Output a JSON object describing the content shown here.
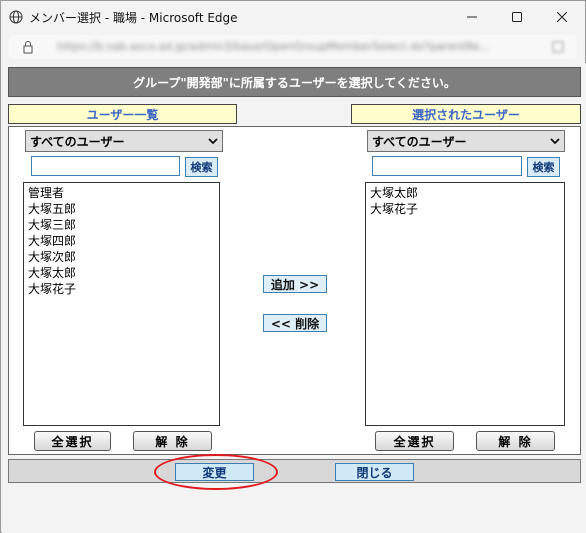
{
  "window": {
    "title": "メンバー選択 - 職場 - Microsoft Edge",
    "url": "https://b.sab.asco.ad.jp/admin3/base/OpenGroupMemberSelect.do?parentRe..."
  },
  "header": {
    "message": "グループ\"開発部\"に所属するユーザーを選択してください。"
  },
  "left_panel": {
    "label": "ユーザー一覧",
    "filter_selected": "すべてのユーザー",
    "search_value": "",
    "search_button": "検索",
    "items": [
      "管理者",
      "大塚五郎",
      "大塚三郎",
      "大塚四郎",
      "大塚次郎",
      "大塚太郎",
      "大塚花子"
    ],
    "select_all_button": "全選択",
    "clear_button": "解 除"
  },
  "right_panel": {
    "label": "選択されたユーザー",
    "filter_selected": "すべてのユーザー",
    "search_value": "",
    "search_button": "検索",
    "items": [
      "大塚太郎",
      "大塚花子"
    ],
    "select_all_button": "全選択",
    "clear_button": "解 除"
  },
  "actions": {
    "add_button": "追加 >>",
    "remove_button": "<< 削除"
  },
  "footer": {
    "change_button": "変更",
    "close_button": "閉じる"
  },
  "colors": {
    "header_bg": "#7f7f7f",
    "panel_label_bg": "#ffffcc",
    "panel_label_text": "#3a66c4",
    "button_border": "#3c7fb1",
    "highlight": "#e0191e"
  }
}
